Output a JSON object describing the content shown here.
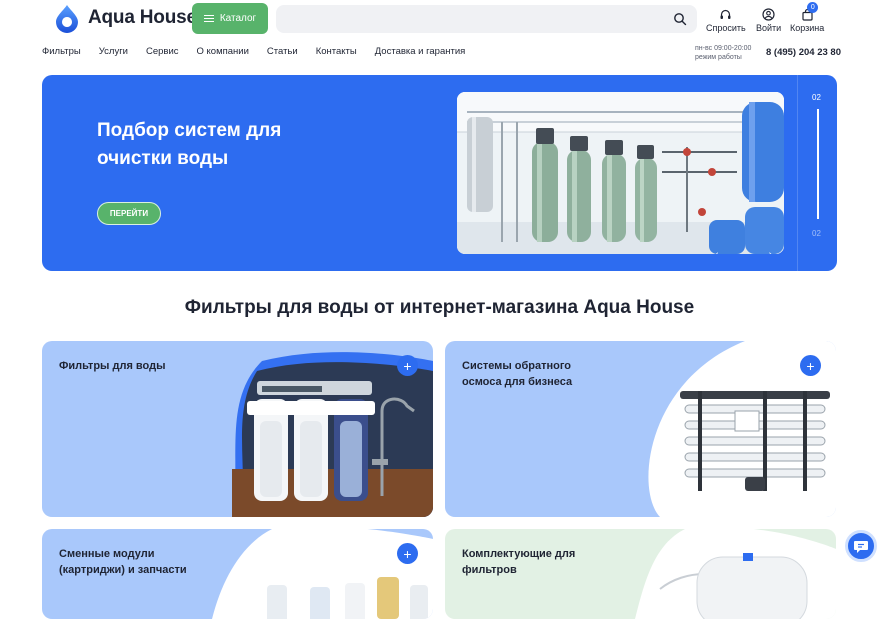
{
  "brand": {
    "name": "Aqua House"
  },
  "header": {
    "catalog_label": "Каталог",
    "search_placeholder": "",
    "ask_label": "Спросить",
    "login_label": "Войти",
    "cart_label": "Корзина",
    "cart_count": "0"
  },
  "nav": {
    "items": [
      "Фильтры",
      "Услуги",
      "Сервис",
      "О компании",
      "Статьи",
      "Контакты",
      "Доставка и гарантия"
    ]
  },
  "contact": {
    "hours_days": "пн-вс 09:00-20:00",
    "hours_label": "режим работы",
    "phone": "8 (495) 204 23 80"
  },
  "hero": {
    "title": "Подбор систем для очистки воды",
    "button_label": "ПЕРЕЙТИ",
    "slide_current": "02",
    "slide_total": "02",
    "prev_arrow": "←",
    "next_arrow": "→"
  },
  "section": {
    "title": "Фильтры для воды от интернет-магазина Aqua House"
  },
  "cards": [
    {
      "title": "Фильтры для воды",
      "plus": "+"
    },
    {
      "title": "Системы обратного осмоса для бизнеса",
      "plus": "+"
    },
    {
      "title": "Сменные модули (картриджи) и запчасти",
      "plus": "+"
    },
    {
      "title": "Комплектующие для фильтров",
      "plus": "+"
    }
  ],
  "colors": {
    "accent_blue": "#2d6cf0",
    "accent_green": "#58b36b",
    "card_light_blue": "#a9c8fb",
    "card_light_green": "#e2f1e4"
  }
}
